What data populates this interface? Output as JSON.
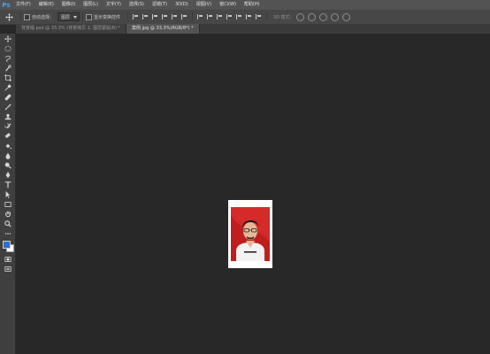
{
  "app": {
    "logo": "Ps"
  },
  "menu": [
    "文件(F)",
    "编辑(E)",
    "图像(I)",
    "图层(L)",
    "文字(Y)",
    "选择(S)",
    "滤镜(T)",
    "3D(D)",
    "视图(V)",
    "窗口(W)",
    "帮助(H)"
  ],
  "options": {
    "auto_select_label": "自动选择：",
    "layer_select_value": "图层",
    "transform_label": "显示变换控件",
    "mode_3d_label": "3D 模式："
  },
  "tabs": [
    {
      "label": "背景版.psd @ 33.3% (背景拷贝 2, 图层蒙版/8) *"
    },
    {
      "label": "案例.jpg @ 33.3%(RGB/8*) *"
    }
  ],
  "tools": [
    "move-tool",
    "marquee-tool",
    "lasso-tool",
    "quick-select-tool",
    "crop-tool",
    "eyedropper-tool",
    "healing-tool",
    "brush-tool",
    "clone-stamp-tool",
    "history-brush-tool",
    "eraser-tool",
    "gradient-tool",
    "blur-tool",
    "dodge-tool",
    "pen-tool",
    "type-tool",
    "path-select-tool",
    "rectangle-tool",
    "hand-tool",
    "zoom-tool",
    "more-tools"
  ],
  "colors": {
    "foreground": "#2a6fd0",
    "background": "#ffffff",
    "photo_bg": "#c01e1e"
  }
}
